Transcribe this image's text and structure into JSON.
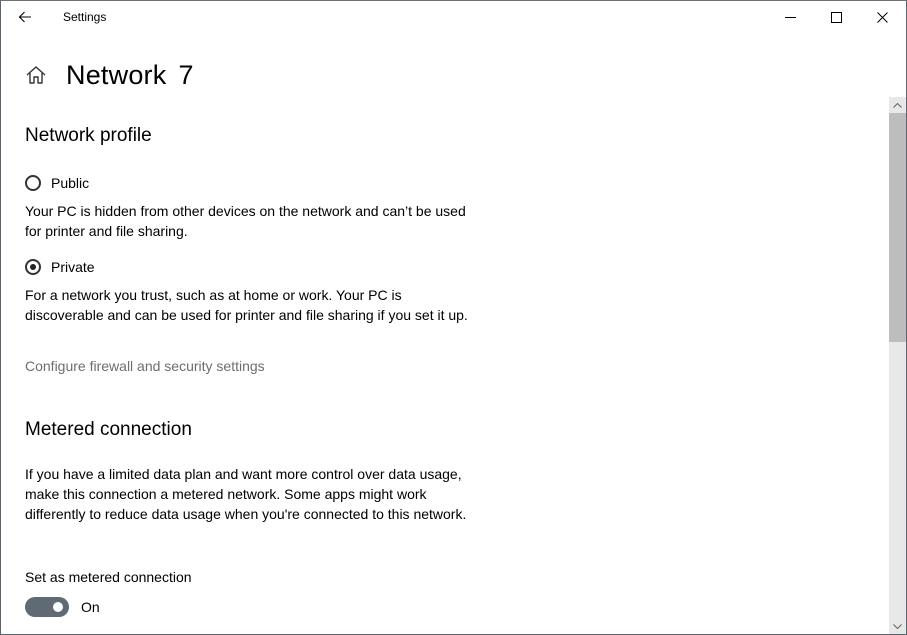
{
  "window": {
    "app_title": "Settings",
    "back_icon": "arrow-left-icon",
    "controls": {
      "minimize_icon": "minimize-icon",
      "maximize_icon": "maximize-icon",
      "close_icon": "close-icon"
    }
  },
  "header": {
    "home_icon": "home-icon",
    "title": "Network",
    "title_number": "7"
  },
  "network_profile": {
    "heading": "Network profile",
    "options": [
      {
        "label": "Public",
        "selected": false,
        "description": "Your PC is hidden from other devices on the network and can’t be used for printer and file sharing."
      },
      {
        "label": "Private",
        "selected": true,
        "description": "For a network you trust, such as at home or work. Your PC is discoverable and can be used for printer and file sharing if you set it up."
      }
    ],
    "firewall_link": "Configure firewall and security settings"
  },
  "metered_connection": {
    "heading": "Metered connection",
    "description": "If you have a limited data plan and want more control over data usage, make this connection a metered network. Some apps might work differently to reduce data usage when you're connected to this network.",
    "toggle_label": "Set as metered connection",
    "toggle_state": "On",
    "toggle_on": true
  },
  "colors": {
    "toggle_on": "#5f6a74",
    "link": "#6d6d6d",
    "scroll_track": "#e8e8e8",
    "scroll_thumb": "#bdbdbd"
  }
}
